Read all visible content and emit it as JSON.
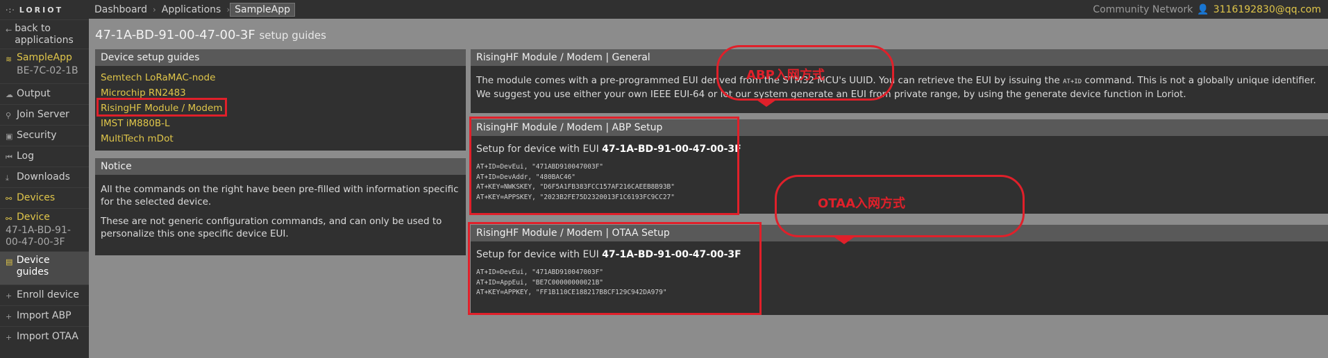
{
  "sidebar": {
    "logo_mark": "·:·",
    "logo_text": "LORIOT",
    "back_label": "back to applications",
    "app_name": "SampleApp",
    "app_id": "BE-7C-02-1B",
    "items": [
      {
        "icon": "cloud-icon",
        "glyph": "☁",
        "label": "Output"
      },
      {
        "icon": "server-icon",
        "glyph": "⚲",
        "label": "Join Server"
      },
      {
        "icon": "lock-icon",
        "glyph": "🔒",
        "label": "Security"
      },
      {
        "icon": "log-icon",
        "glyph": "⏮",
        "label": "Log"
      },
      {
        "icon": "download-icon",
        "glyph": "⤓",
        "label": "Downloads"
      }
    ],
    "devices_label": "Devices",
    "device_label": "Device",
    "device_eui": "47-1A-BD-91-00-47-00-3F",
    "guides_label": "Device guides",
    "bottom_items": [
      {
        "icon": "plus-icon",
        "glyph": "+",
        "label": "Enroll device"
      },
      {
        "icon": "plus-icon",
        "glyph": "+",
        "label": "Import ABP"
      },
      {
        "icon": "plus-icon",
        "glyph": "+",
        "label": "Import OTAA"
      }
    ]
  },
  "topbar": {
    "breadcrumbs": [
      "Dashboard",
      "Applications",
      "SampleApp"
    ],
    "network": "Community Network",
    "user": "3116192830@qq.com"
  },
  "page": {
    "title_eui": "47-1A-BD-91-00-47-00-3F",
    "title_suffix": "setup guides"
  },
  "guides_panel": {
    "title": "Device setup guides",
    "links": [
      "Semtech LoRaMAC-node",
      "Microchip RN2483",
      "RisingHF Module / Modem",
      "IMST iM880B-L",
      "MultiTech mDot"
    ]
  },
  "notice_panel": {
    "title": "Notice",
    "p1": "All the commands on the right have been pre-filled with information specific for the selected device.",
    "p2": "These are not generic configuration commands, and can only be used to personalize this one specific device EUI."
  },
  "general_panel": {
    "title": "RisingHF Module / Modem | General",
    "text_a": "The module comes with a pre-programmed EUI derived from the STM32 MCU's UUID. You can retrieve the EUI by issuing the ",
    "code": "AT+ID",
    "text_b": " command. This is not a globally unique identifier. We suggest you use either your own IEEE EUI-64 or let our system generate an EUI from private range, by using the generate device function in Loriot."
  },
  "abp_panel": {
    "title": "RisingHF Module / Modem | ABP Setup",
    "setup_prefix": "Setup for device with EUI",
    "eui": "47-1A-BD-91-00-47-00-3F",
    "commands": "AT+ID=DevEui, \"471ABD910047003F\"\nAT+ID=DevAddr, \"480BAC46\"\nAT+KEY=NWKSKEY, \"D6F5A1FB383FCC157AF216CAEEB8B93B\"\nAT+KEY=APPSKEY, \"2023B2FE75D2320013F1C6193FC9CC27\""
  },
  "otaa_panel": {
    "title": "RisingHF Module / Modem | OTAA Setup",
    "setup_prefix": "Setup for device with EUI",
    "eui": "47-1A-BD-91-00-47-00-3F",
    "commands": "AT+ID=DevEui, \"471ABD910047003F\"\nAT+ID=AppEui, \"BE7C00000000021B\"\nAT+KEY=APPKEY, \"FF1B110CE188217B8CF129C942DA979\""
  },
  "annotations": {
    "abp_label": "ABP入网方式",
    "otaa_label": "OTAA入网方式",
    "color": "#e0202a"
  }
}
